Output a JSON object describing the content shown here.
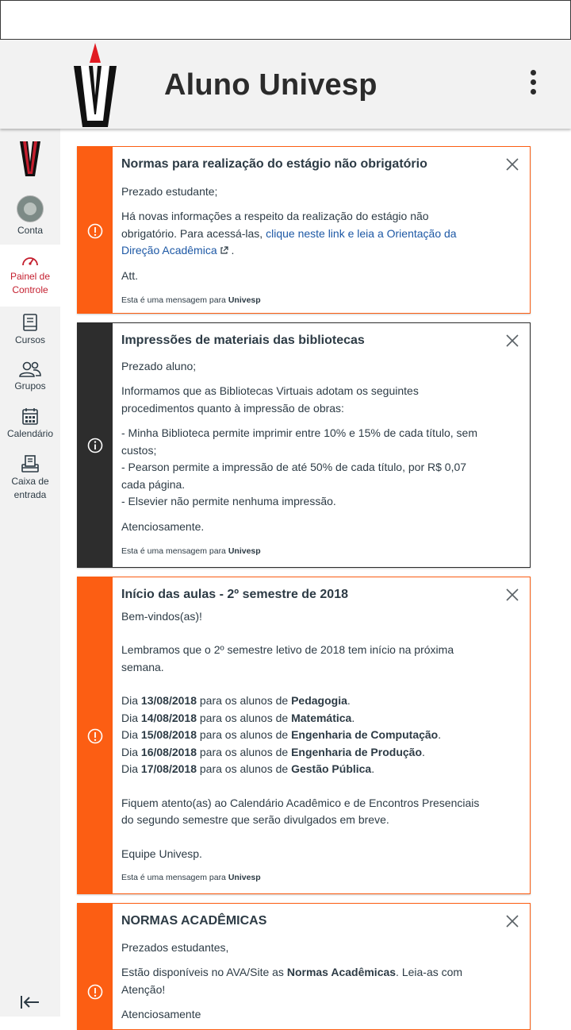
{
  "app": {
    "title": "Aluno Univesp"
  },
  "colors": {
    "brand_red": "#e11b22",
    "accent_orange": "#fc5e13",
    "dark": "#2d2d2d",
    "link": "#1d58a5"
  },
  "nav": {
    "items": [
      {
        "label": "Conta",
        "icon": "avatar"
      },
      {
        "label": "Painel de Controle",
        "icon": "dashboard-icon"
      },
      {
        "label": "Cursos",
        "icon": "book-icon"
      },
      {
        "label": "Grupos",
        "icon": "groups-icon"
      },
      {
        "label": "Calendário",
        "icon": "calendar-icon"
      },
      {
        "label": "Caixa de entrada",
        "icon": "inbox-icon"
      }
    ]
  },
  "cards": [
    {
      "title": "Normas para realização do estágio não obrigatório",
      "greeting": "Prezado estudante;",
      "text_1": "Há novas informações a respeito da realização do estágio não obrigatório. Para acessá-las,",
      "link": "clique neste link e leia a Orientação da Direção Acadêmica",
      "text_2": ".",
      "signoff": "Att.",
      "footer_prefix": "Esta é uma mensagem para",
      "footer_target": "Univesp"
    },
    {
      "title": "Impressões de materiais das bibliotecas",
      "greeting": "Prezado aluno;",
      "intro": "Informamos que as Bibliotecas Virtuais adotam os seguintes procedimentos quanto à impressão de obras:",
      "item_1": "- Minha Biblioteca permite imprimir entre 10% e 15% de cada título, sem custos;",
      "item_2": "- Pearson permite a impressão de até 50% de cada título, por R$ 0,07 cada página.",
      "item_3": "- Elsevier não permite nenhuma impressão.",
      "signoff": "Atenciosamente.",
      "footer_prefix": "Esta é uma mensagem para",
      "footer_target": "Univesp"
    },
    {
      "title": "Início das aulas - 2º semestre de 2018",
      "greeting": "Bem-vindos(as)!",
      "intro": "Lembramos que o 2º semestre letivo de 2018 tem início na próxima semana.",
      "schedule": [
        {
          "pre": "Dia",
          "date": "13/08/2018",
          "mid": "para os alunos de",
          "course": "Pedagogia"
        },
        {
          "pre": "Dia",
          "date": "14/08/2018",
          "mid": "para os alunos de",
          "course": "Matemática"
        },
        {
          "pre": "Dia",
          "date": "15/08/2018",
          "mid": "para os alunos de",
          "course": "Engenharia de Computação"
        },
        {
          "pre": "Dia",
          "date": "16/08/2018",
          "mid": "para os alunos de",
          "course": "Engenharia de Produção"
        },
        {
          "pre": "Dia",
          "date": "17/08/2018",
          "mid": "para os alunos de",
          "course": "Gestão Pública"
        }
      ],
      "outro": "Fiquem atento(as) ao Calendário Acadêmico e de Encontros Presenciais do segundo semestre que serão divulgados em breve.",
      "signoff": "Equipe Univesp.",
      "footer_prefix": "Esta é uma mensagem para",
      "footer_target": "Univesp"
    },
    {
      "title": "NORMAS ACADÊMICAS",
      "greeting": "Prezados estudantes,",
      "text_1": "Estão disponíveis no AVA/Site as",
      "bold": "Normas Acadêmicas",
      "text_2": ". Leia-as com Atenção!",
      "signoff": "Atenciosamente"
    }
  ]
}
